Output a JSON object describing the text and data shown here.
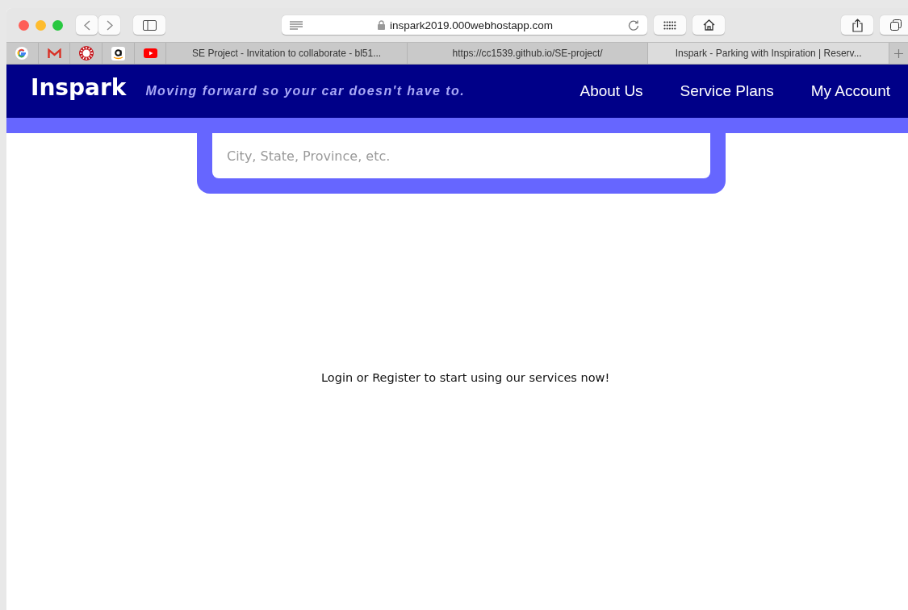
{
  "browser": {
    "address": "inspark2019.000webhostapp.com",
    "pinned_tabs": [
      {
        "kind": "google",
        "selected": false
      },
      {
        "kind": "mail",
        "selected": false
      },
      {
        "kind": "sun",
        "selected": false
      },
      {
        "kind": "amazon",
        "selected": false
      },
      {
        "kind": "video",
        "selected": false
      }
    ],
    "tabs": [
      {
        "title": "SE Project - Invitation to collaborate - bl51...",
        "selected": false
      },
      {
        "title": "https://cc1539.github.io/SE-project/",
        "selected": false
      },
      {
        "title": "Inspark - Parking with Inspiration | Reserv...",
        "selected": true
      }
    ]
  },
  "site": {
    "logo": "Inspark",
    "tagline": "Moving forward so your car doesn't have to.",
    "nav": [
      "About Us",
      "Service Plans",
      "My Account"
    ],
    "search": {
      "placeholder": "City, State, Province, etc."
    },
    "message": "Login or Register to start using our services now!"
  }
}
